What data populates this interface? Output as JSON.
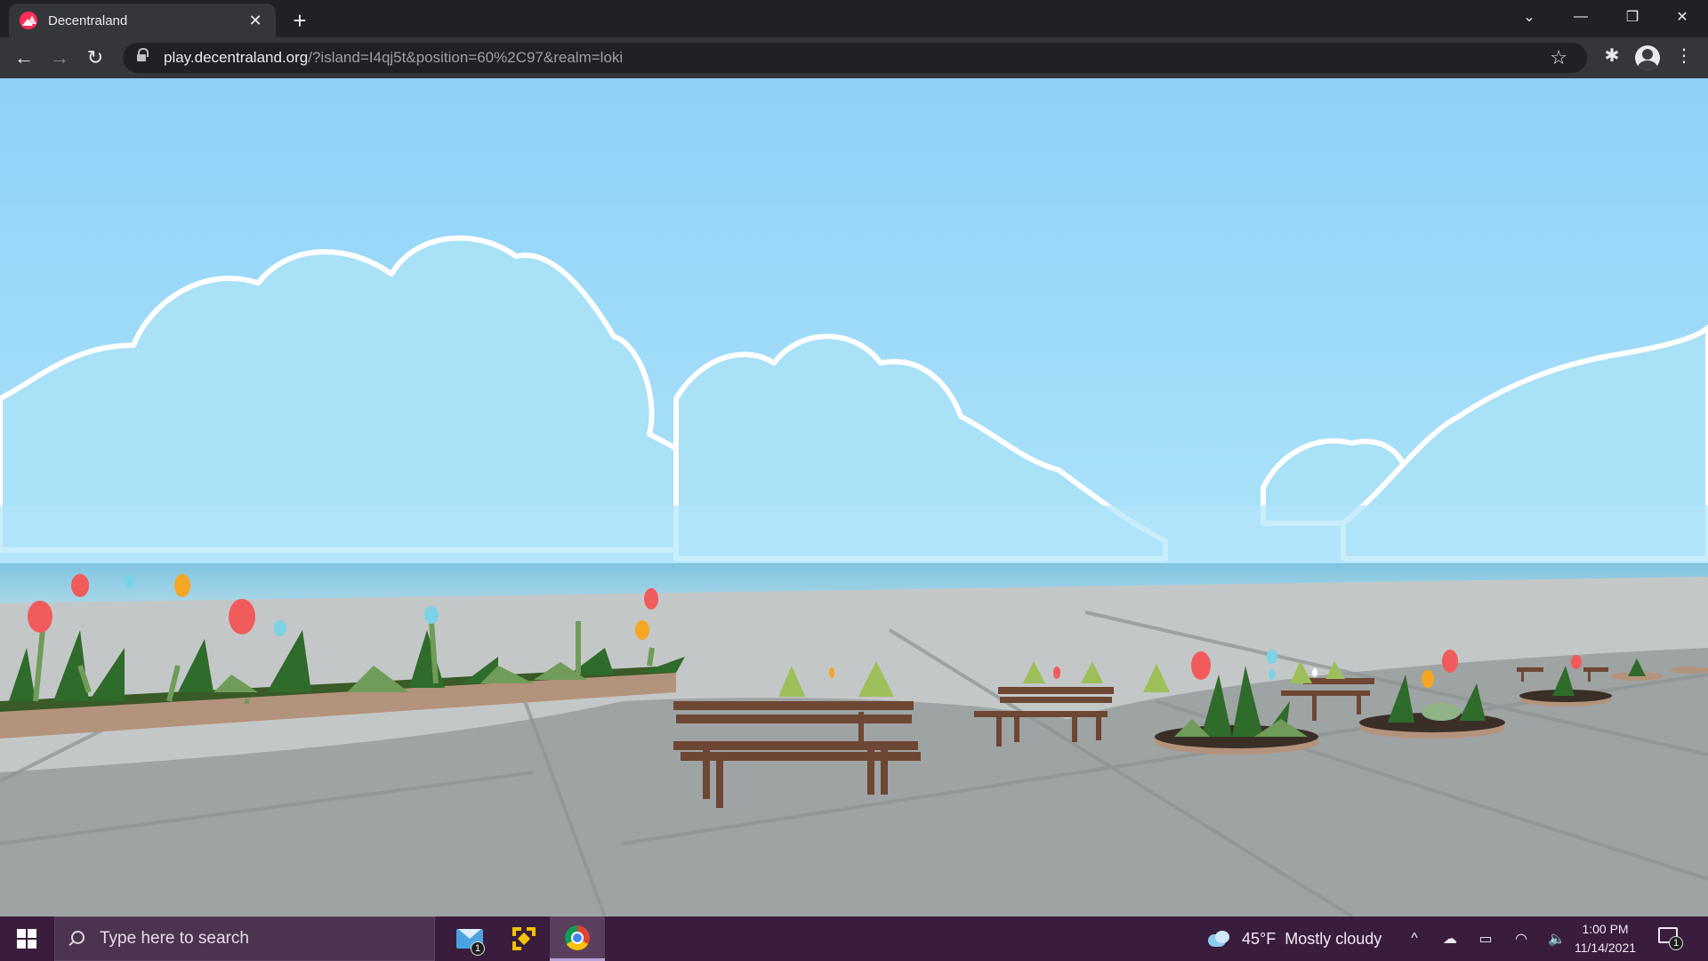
{
  "browser": {
    "tab": {
      "title": "Decentraland",
      "close_label": "✕"
    },
    "new_tab_label": "+",
    "window_controls": {
      "tab_search": "⌄",
      "minimize": "—",
      "restore": "❐",
      "close": "✕"
    },
    "nav": {
      "back": "←",
      "forward": "→",
      "reload": "↻"
    },
    "address": {
      "host": "play.decentraland.org",
      "path": "/?island=I4qj5t&position=60%2C97&realm=loki"
    },
    "toolbar_icons": {
      "bookmark": "☆",
      "extensions": "✱",
      "menu": "⋮"
    },
    "favicon_color": "#ff2d55"
  },
  "scene": {
    "description_icon": "decentraland-plaza-scene",
    "sky_color_top": "#8fd3f7",
    "sky_color_bottom": "#b6e6fb",
    "floor_color": "#b9bcbc",
    "shadow_color": "#9aa0a0",
    "bench_color": "#6b4432"
  },
  "taskbar": {
    "search_placeholder": "Type here to search",
    "mail_badge": "1",
    "weather": {
      "temp": "45°F",
      "condition": "Mostly cloudy"
    },
    "tray_icons": {
      "chevron": "^",
      "onedrive": "☁",
      "battery": "▭",
      "wifi": "◠",
      "volume": "🔈"
    },
    "clock": {
      "time": "1:00 PM",
      "date": "11/14/2021"
    },
    "notification_badge": "1",
    "background_color": "#3a1d3c"
  }
}
